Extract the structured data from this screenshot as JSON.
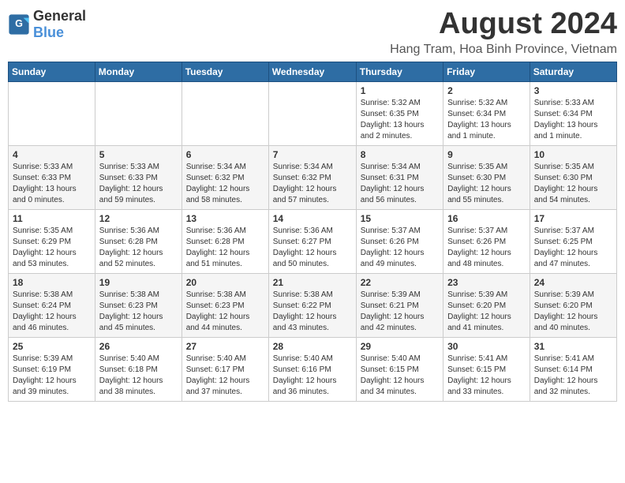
{
  "logo": {
    "general": "General",
    "blue": "Blue"
  },
  "title": "August 2024",
  "subtitle": "Hang Tram, Hoa Binh Province, Vietnam",
  "days": [
    "Sunday",
    "Monday",
    "Tuesday",
    "Wednesday",
    "Thursday",
    "Friday",
    "Saturday"
  ],
  "weeks": [
    [
      {
        "day": "",
        "info": ""
      },
      {
        "day": "",
        "info": ""
      },
      {
        "day": "",
        "info": ""
      },
      {
        "day": "",
        "info": ""
      },
      {
        "day": "1",
        "info": "Sunrise: 5:32 AM\nSunset: 6:35 PM\nDaylight: 13 hours\nand 2 minutes."
      },
      {
        "day": "2",
        "info": "Sunrise: 5:32 AM\nSunset: 6:34 PM\nDaylight: 13 hours\nand 1 minute."
      },
      {
        "day": "3",
        "info": "Sunrise: 5:33 AM\nSunset: 6:34 PM\nDaylight: 13 hours\nand 1 minute."
      }
    ],
    [
      {
        "day": "4",
        "info": "Sunrise: 5:33 AM\nSunset: 6:33 PM\nDaylight: 13 hours\nand 0 minutes."
      },
      {
        "day": "5",
        "info": "Sunrise: 5:33 AM\nSunset: 6:33 PM\nDaylight: 12 hours\nand 59 minutes."
      },
      {
        "day": "6",
        "info": "Sunrise: 5:34 AM\nSunset: 6:32 PM\nDaylight: 12 hours\nand 58 minutes."
      },
      {
        "day": "7",
        "info": "Sunrise: 5:34 AM\nSunset: 6:32 PM\nDaylight: 12 hours\nand 57 minutes."
      },
      {
        "day": "8",
        "info": "Sunrise: 5:34 AM\nSunset: 6:31 PM\nDaylight: 12 hours\nand 56 minutes."
      },
      {
        "day": "9",
        "info": "Sunrise: 5:35 AM\nSunset: 6:30 PM\nDaylight: 12 hours\nand 55 minutes."
      },
      {
        "day": "10",
        "info": "Sunrise: 5:35 AM\nSunset: 6:30 PM\nDaylight: 12 hours\nand 54 minutes."
      }
    ],
    [
      {
        "day": "11",
        "info": "Sunrise: 5:35 AM\nSunset: 6:29 PM\nDaylight: 12 hours\nand 53 minutes."
      },
      {
        "day": "12",
        "info": "Sunrise: 5:36 AM\nSunset: 6:28 PM\nDaylight: 12 hours\nand 52 minutes."
      },
      {
        "day": "13",
        "info": "Sunrise: 5:36 AM\nSunset: 6:28 PM\nDaylight: 12 hours\nand 51 minutes."
      },
      {
        "day": "14",
        "info": "Sunrise: 5:36 AM\nSunset: 6:27 PM\nDaylight: 12 hours\nand 50 minutes."
      },
      {
        "day": "15",
        "info": "Sunrise: 5:37 AM\nSunset: 6:26 PM\nDaylight: 12 hours\nand 49 minutes."
      },
      {
        "day": "16",
        "info": "Sunrise: 5:37 AM\nSunset: 6:26 PM\nDaylight: 12 hours\nand 48 minutes."
      },
      {
        "day": "17",
        "info": "Sunrise: 5:37 AM\nSunset: 6:25 PM\nDaylight: 12 hours\nand 47 minutes."
      }
    ],
    [
      {
        "day": "18",
        "info": "Sunrise: 5:38 AM\nSunset: 6:24 PM\nDaylight: 12 hours\nand 46 minutes."
      },
      {
        "day": "19",
        "info": "Sunrise: 5:38 AM\nSunset: 6:23 PM\nDaylight: 12 hours\nand 45 minutes."
      },
      {
        "day": "20",
        "info": "Sunrise: 5:38 AM\nSunset: 6:23 PM\nDaylight: 12 hours\nand 44 minutes."
      },
      {
        "day": "21",
        "info": "Sunrise: 5:38 AM\nSunset: 6:22 PM\nDaylight: 12 hours\nand 43 minutes."
      },
      {
        "day": "22",
        "info": "Sunrise: 5:39 AM\nSunset: 6:21 PM\nDaylight: 12 hours\nand 42 minutes."
      },
      {
        "day": "23",
        "info": "Sunrise: 5:39 AM\nSunset: 6:20 PM\nDaylight: 12 hours\nand 41 minutes."
      },
      {
        "day": "24",
        "info": "Sunrise: 5:39 AM\nSunset: 6:20 PM\nDaylight: 12 hours\nand 40 minutes."
      }
    ],
    [
      {
        "day": "25",
        "info": "Sunrise: 5:39 AM\nSunset: 6:19 PM\nDaylight: 12 hours\nand 39 minutes."
      },
      {
        "day": "26",
        "info": "Sunrise: 5:40 AM\nSunset: 6:18 PM\nDaylight: 12 hours\nand 38 minutes."
      },
      {
        "day": "27",
        "info": "Sunrise: 5:40 AM\nSunset: 6:17 PM\nDaylight: 12 hours\nand 37 minutes."
      },
      {
        "day": "28",
        "info": "Sunrise: 5:40 AM\nSunset: 6:16 PM\nDaylight: 12 hours\nand 36 minutes."
      },
      {
        "day": "29",
        "info": "Sunrise: 5:40 AM\nSunset: 6:15 PM\nDaylight: 12 hours\nand 34 minutes."
      },
      {
        "day": "30",
        "info": "Sunrise: 5:41 AM\nSunset: 6:15 PM\nDaylight: 12 hours\nand 33 minutes."
      },
      {
        "day": "31",
        "info": "Sunrise: 5:41 AM\nSunset: 6:14 PM\nDaylight: 12 hours\nand 32 minutes."
      }
    ]
  ]
}
